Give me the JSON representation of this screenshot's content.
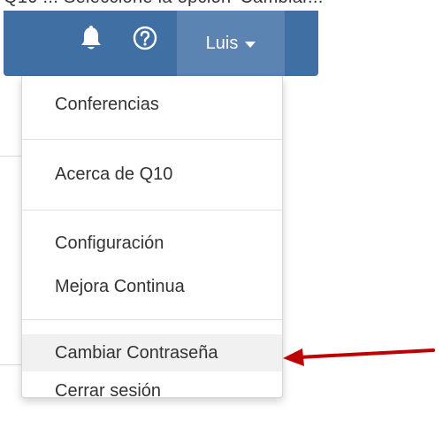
{
  "header": {
    "cropped_text": "Q10 ... Seleccione la opción 'Cambiar...",
    "user_name": "Luis",
    "icons": [
      "bell-icon",
      "help-icon",
      "caret-down-icon"
    ],
    "bar_color": "#3f6fa3",
    "user_tab_color": "#5b84b3"
  },
  "dropdown": {
    "items": [
      {
        "label": "Conferencias"
      },
      {
        "label": "Acerca de Q10"
      },
      {
        "label": "Configuración"
      },
      {
        "label": "Mejora Continua"
      },
      {
        "label": "Cambiar Contraseña"
      },
      {
        "label": "Cerrar sesión"
      }
    ],
    "highlighted_item": "Cambiar Contraseña"
  },
  "annotation": {
    "arrow_color": "#c00000",
    "points_to": "Cambiar Contraseña"
  }
}
